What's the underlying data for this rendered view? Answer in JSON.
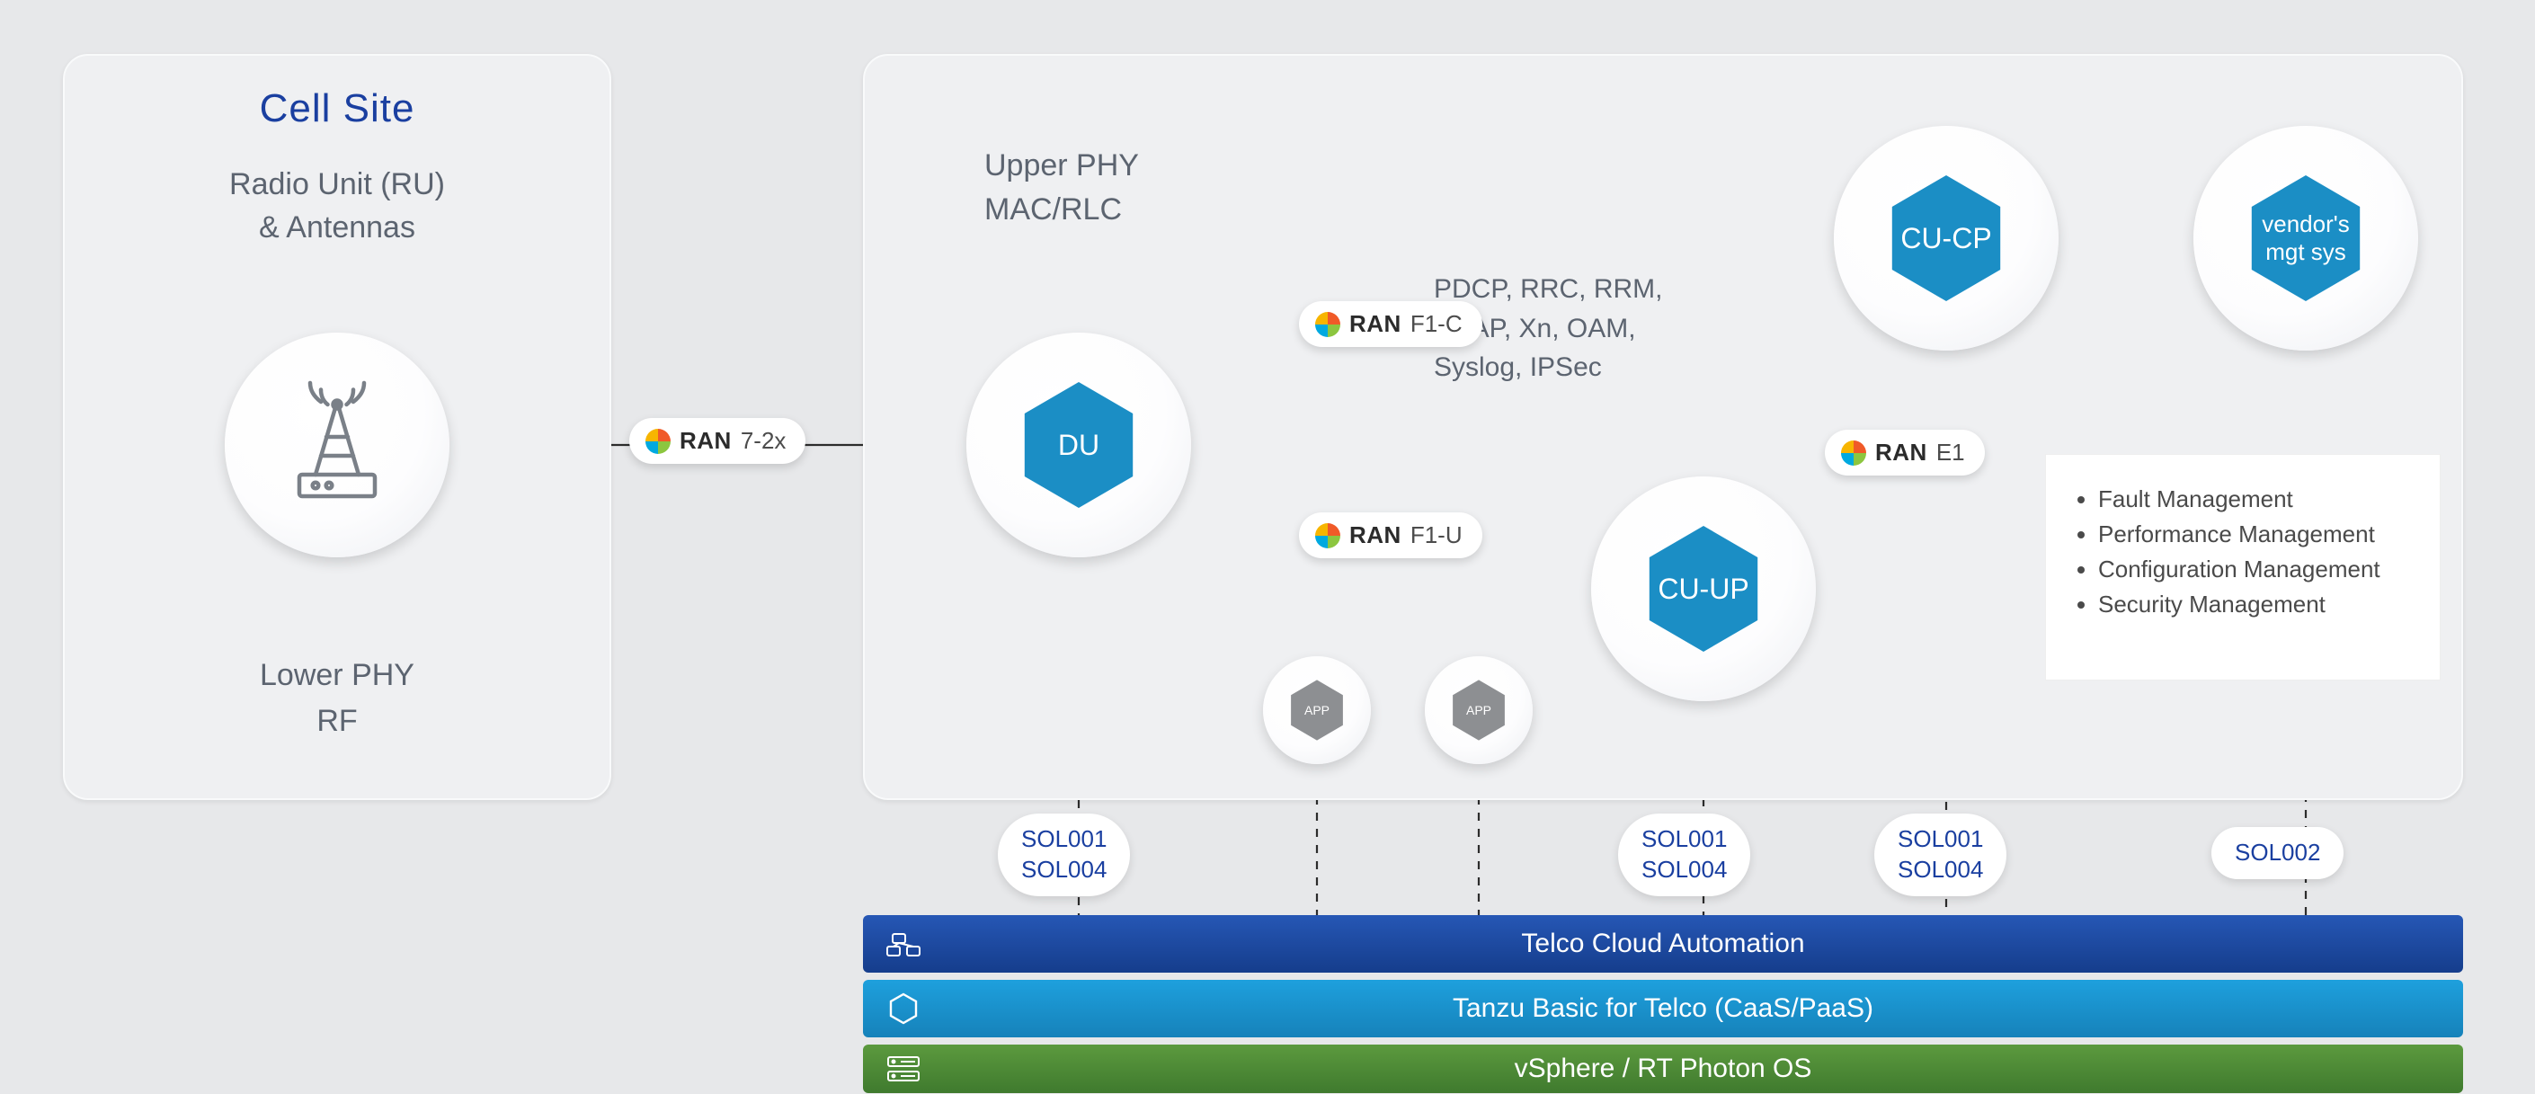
{
  "cell_site": {
    "title": "Cell Site",
    "subtitle_line1": "Radio Unit (RU)",
    "subtitle_line2": "& Antennas",
    "bottom_line1": "Lower PHY",
    "bottom_line2": "RF"
  },
  "upper_phy": {
    "line1": "Upper PHY",
    "line2": "MAC/RLC"
  },
  "pdcp": {
    "line1": "PDCP, RRC, RRM,",
    "line2": "SDAP, Xn, OAM,",
    "line3": "Syslog, IPSec"
  },
  "nodes": {
    "du": "DU",
    "cuup": "CU-UP",
    "cucp": "CU-CP",
    "vendor_line1": "vendor's",
    "vendor_line2": "mgt sys",
    "app": "APP"
  },
  "pills": {
    "oran_brand": "RAN",
    "i72x": "7-2x",
    "f1c": "F1-C",
    "f1u": "F1-U",
    "e1": "E1"
  },
  "sol": {
    "du_line1": "SOL001",
    "du_line2": "SOL004",
    "cuup_line1": "SOL001",
    "cuup_line2": "SOL004",
    "cucp_line1": "SOL001",
    "cucp_line2": "SOL004",
    "vms": "SOL002"
  },
  "mgmt": {
    "items": [
      "Fault Management",
      "Performance Management",
      "Configuration Management",
      "Security Management"
    ]
  },
  "bars": {
    "tca": "Telco Cloud Automation",
    "tanzu": "Tanzu Basic for Telco (CaaS/PaaS)",
    "vsphere": "vSphere / RT Photon OS"
  }
}
